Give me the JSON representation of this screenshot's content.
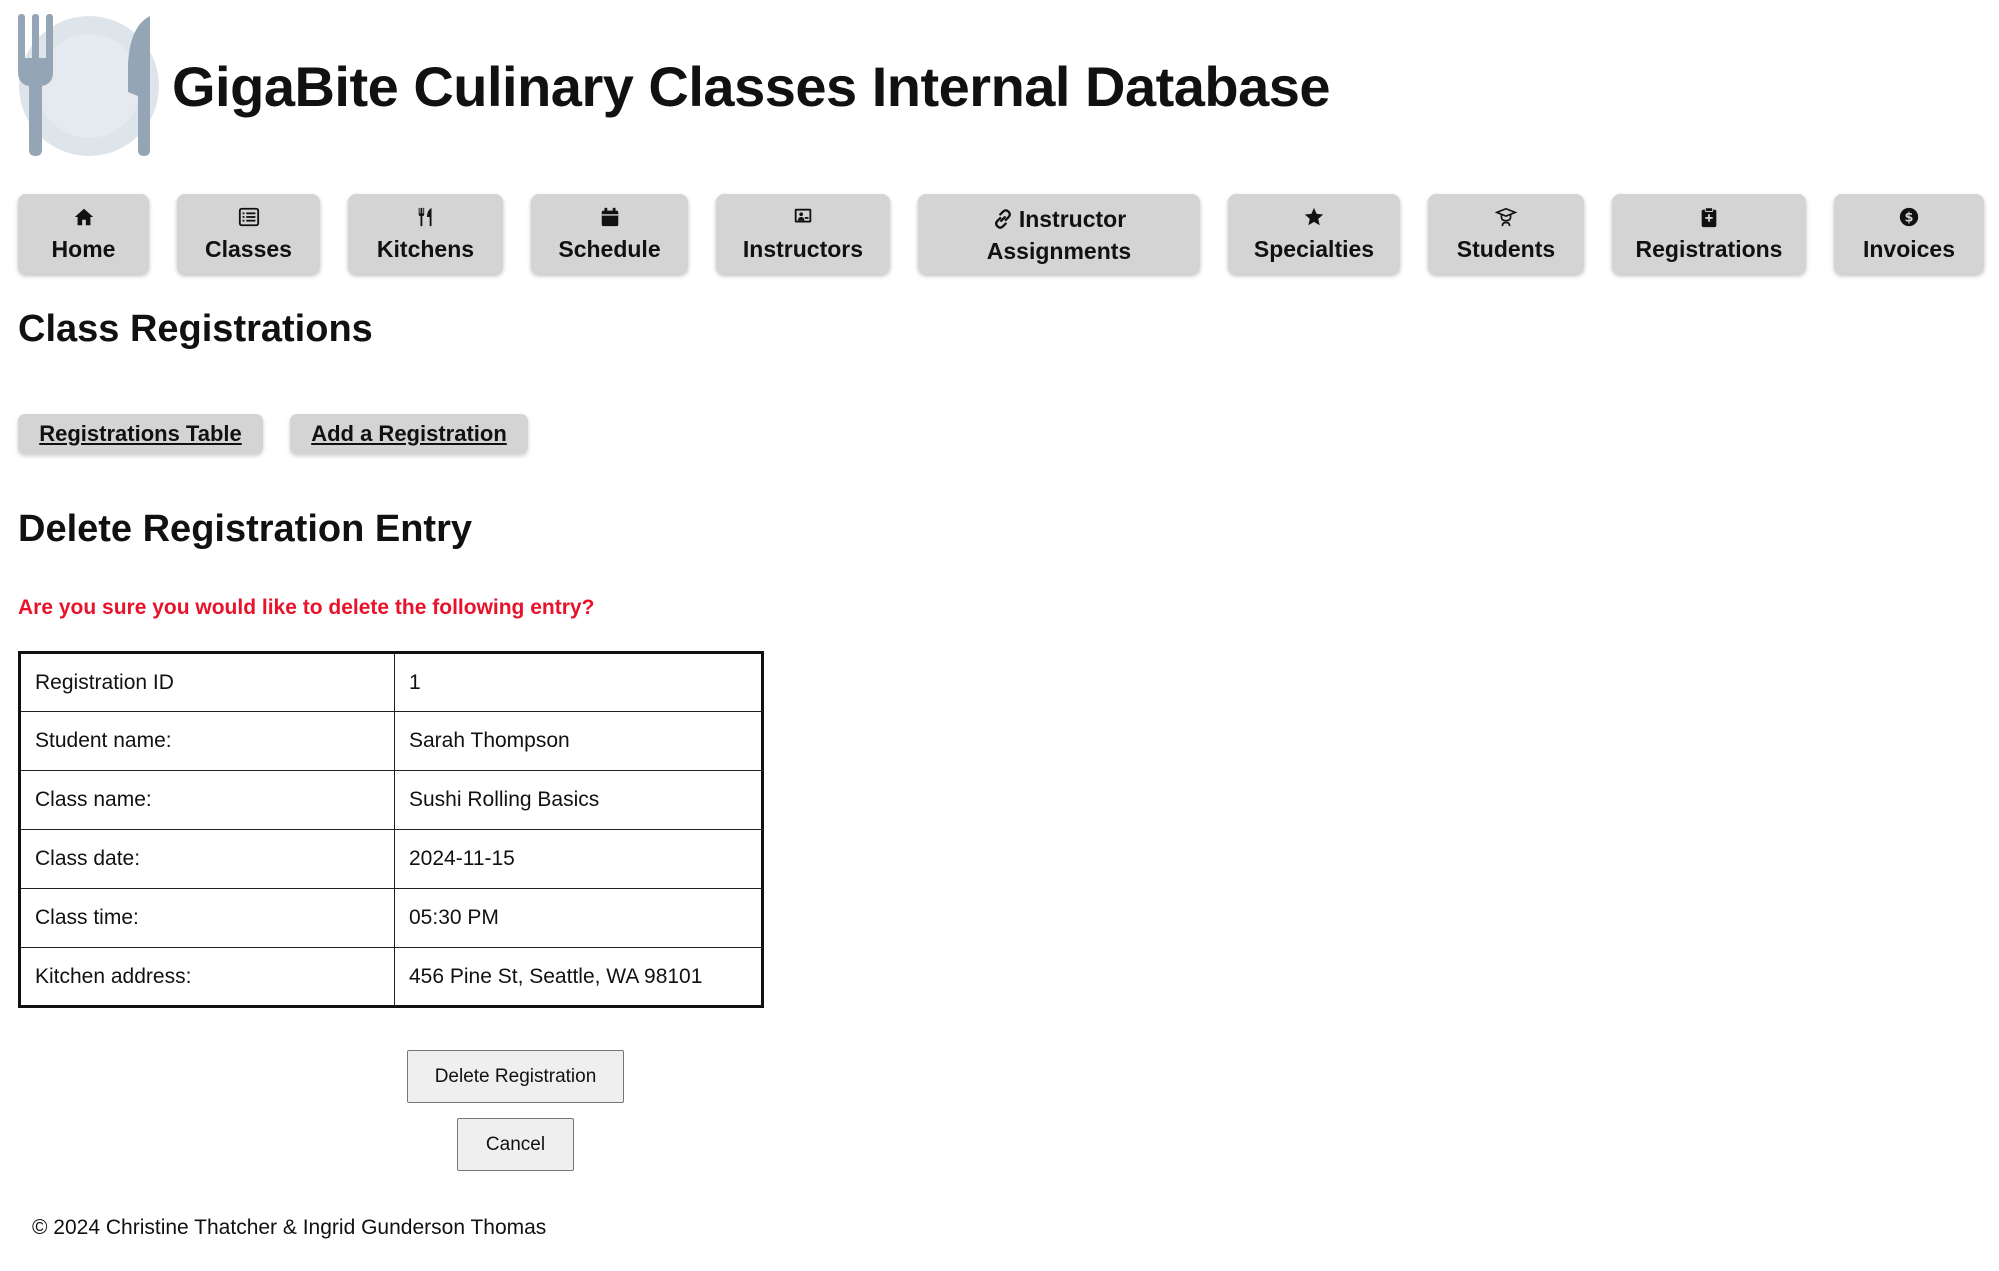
{
  "header": {
    "title": "GigaBite Culinary Classes Internal Database",
    "logo_icon": "plate-fork-knife-icon"
  },
  "nav": {
    "items": [
      {
        "label": "Home",
        "icon": "home-icon"
      },
      {
        "label": "Classes",
        "icon": "list-icon"
      },
      {
        "label": "Kitchens",
        "icon": "utensils-icon"
      },
      {
        "label": "Schedule",
        "icon": "calendar-icon"
      },
      {
        "label": "Instructors",
        "icon": "chalkboard-teacher-icon"
      },
      {
        "label_line1": "Instructor",
        "label_line2": "Assignments",
        "icon": "link-icon"
      },
      {
        "label": "Specialties",
        "icon": "star-icon"
      },
      {
        "label": "Students",
        "icon": "graduate-icon"
      },
      {
        "label": "Registrations",
        "icon": "clipboard-icon"
      },
      {
        "label": "Invoices",
        "icon": "dollar-circle-icon"
      }
    ]
  },
  "section_title": "Class Registrations",
  "subnav": {
    "table_link": "Registrations Table",
    "add_link": "Add a Registration"
  },
  "delete_form": {
    "title": "Delete Registration Entry",
    "warning": "Are you sure you would like to delete the following entry?",
    "warning_color": "#e8132a",
    "rows": [
      {
        "label": "Registration ID",
        "value": "1"
      },
      {
        "label": "Student name:",
        "value": "Sarah Thompson"
      },
      {
        "label": "Class name:",
        "value": "Sushi Rolling Basics"
      },
      {
        "label": "Class date:",
        "value": "2024-11-15"
      },
      {
        "label": "Class time:",
        "value": "05:30 PM"
      },
      {
        "label": "Kitchen address:",
        "value": "456 Pine St, Seattle, WA 98101"
      }
    ],
    "delete_button": "Delete Registration",
    "cancel_button": "Cancel"
  },
  "footer": {
    "text": "© 2024 Christine Thatcher & Ingrid Gunderson Thomas"
  }
}
